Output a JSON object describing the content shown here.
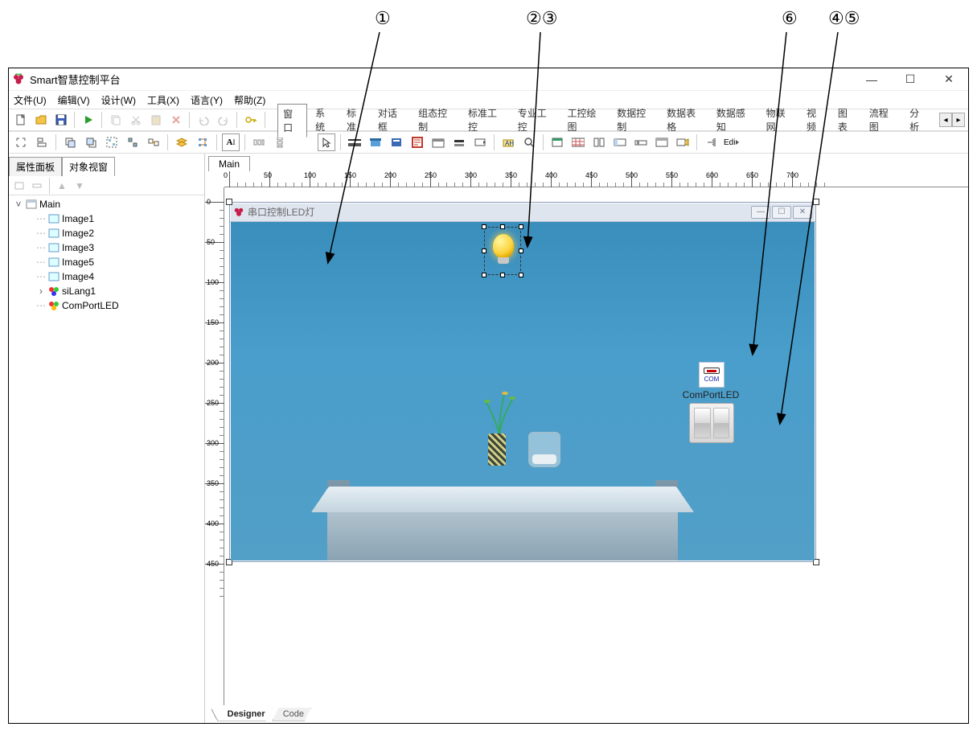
{
  "callouts": [
    "①",
    "②③",
    "⑥",
    "④⑤"
  ],
  "titlebar": {
    "title": "Smart智慧控制平台"
  },
  "menu": {
    "file": "文件(U)",
    "edit": "编辑(V)",
    "design": "设计(W)",
    "tool": "工具(X)",
    "lang": "语言(Y)",
    "help": "帮助(Z)"
  },
  "component_tabs": {
    "window": "窗口",
    "system": "系统",
    "standard": "标准",
    "dialog": "对话框",
    "composite": "组态控制",
    "ind_std": "标准工控",
    "ind_pro": "专业工控",
    "ind_draw": "工控绘图",
    "data_ctrl": "数据控制",
    "data_table": "数据表格",
    "data_sense": "数据感知",
    "iot": "物联网",
    "video": "视频",
    "chart": "图表",
    "flow": "流程图",
    "analyze": "分析"
  },
  "left_panel": {
    "tab_prop": "属性面板",
    "tab_obj": "对象视窗"
  },
  "tree": {
    "root": "Main",
    "items": [
      "Image1",
      "Image2",
      "Image3",
      "Image5",
      "Image4",
      "siLang1",
      "ComPortLED"
    ]
  },
  "editor": {
    "tab_main": "Main"
  },
  "form": {
    "title": "串口控制LED灯",
    "com_label": "ComPortLED",
    "com_icon_text": "COM"
  },
  "ruler_h": [
    "0",
    "50",
    "100",
    "150",
    "200",
    "250",
    "300",
    "350",
    "400",
    "450",
    "500",
    "550",
    "600",
    "650",
    "700"
  ],
  "ruler_v": [
    "0",
    "50",
    "100",
    "150",
    "200",
    "250",
    "300",
    "350",
    "400",
    "450"
  ],
  "bottom_tabs": {
    "designer": "Designer",
    "code": "Code"
  }
}
